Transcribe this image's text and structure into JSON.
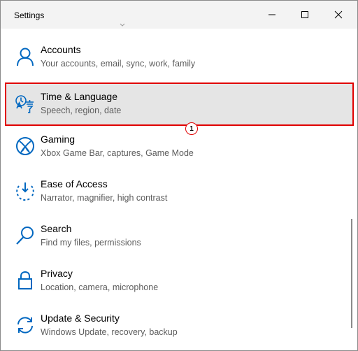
{
  "window": {
    "title": "Settings"
  },
  "accent_color": "#0067c0",
  "highlight_color": "#e00000",
  "items": [
    {
      "label": "Accounts",
      "desc": "Your accounts, email, sync, work, family",
      "icon": "person-icon"
    },
    {
      "label": "Time & Language",
      "desc": "Speech, region, date",
      "icon": "time-language-icon",
      "selected": true
    },
    {
      "label": "Gaming",
      "desc": "Xbox Game Bar, captures, Game Mode",
      "icon": "xbox-icon"
    },
    {
      "label": "Ease of Access",
      "desc": "Narrator, magnifier, high contrast",
      "icon": "ease-of-access-icon"
    },
    {
      "label": "Search",
      "desc": "Find my files, permissions",
      "icon": "search-icon"
    },
    {
      "label": "Privacy",
      "desc": "Location, camera, microphone",
      "icon": "lock-icon"
    },
    {
      "label": "Update & Security",
      "desc": "Windows Update, recovery, backup",
      "icon": "sync-icon"
    }
  ],
  "annotation": {
    "step_number": "1"
  }
}
